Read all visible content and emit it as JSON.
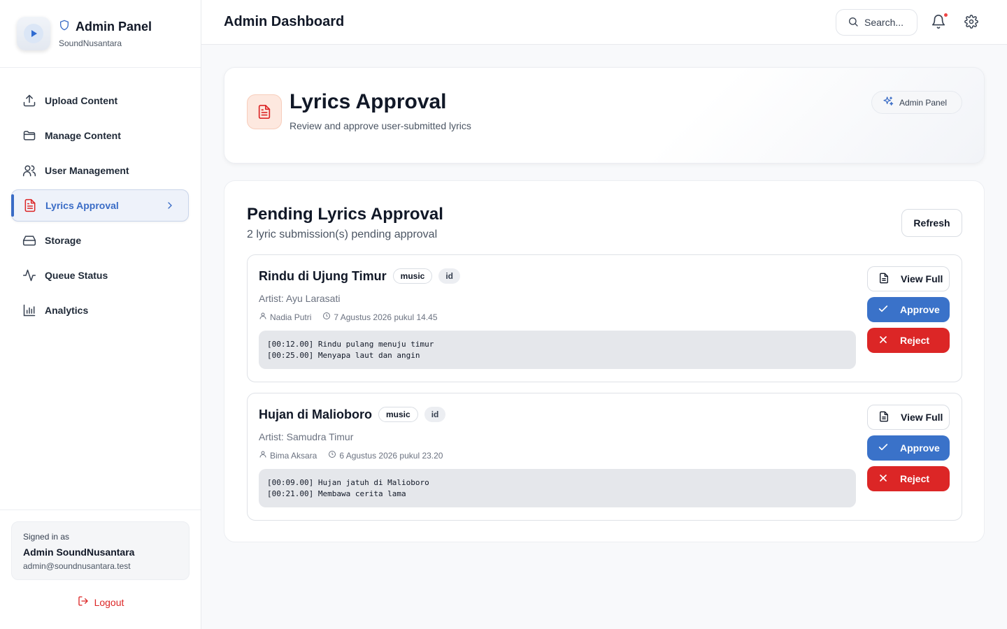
{
  "brand": {
    "title": "Admin Panel",
    "subtitle": "SoundNusantara"
  },
  "nav": [
    {
      "label": "Upload Content",
      "icon": "upload-icon"
    },
    {
      "label": "Manage Content",
      "icon": "folder-icon"
    },
    {
      "label": "User Management",
      "icon": "users-icon"
    },
    {
      "label": "Lyrics Approval",
      "icon": "file-text-icon",
      "active": true
    },
    {
      "label": "Storage",
      "icon": "hard-drive-icon"
    },
    {
      "label": "Queue Status",
      "icon": "activity-icon"
    },
    {
      "label": "Analytics",
      "icon": "bar-chart-icon"
    }
  ],
  "account": {
    "label": "Signed in as",
    "name": "Admin SoundNusantara",
    "email": "admin@soundnusantara.test",
    "logout": "Logout"
  },
  "header": {
    "title": "Admin Dashboard",
    "search_placeholder": "Search..."
  },
  "hero": {
    "title": "Lyrics Approval",
    "subtitle": "Review and approve user-submitted lyrics",
    "badge": "Admin Panel"
  },
  "panel": {
    "title": "Pending Lyrics Approval",
    "subtitle": "2 lyric submission(s) pending approval",
    "refresh": "Refresh",
    "items": [
      {
        "title": "Rindu di Ujung Timur",
        "type_tag": "music",
        "lang_tag": "id",
        "artist": "Artist: Ayu Larasati",
        "submitter": "Nadia Putri",
        "date": "7 Agustus 2026 pukul 14.45",
        "lyrics": "[00:12.00] Rindu pulang menuju timur\n[00:25.00] Menyapa laut dan angin",
        "view": "View Full",
        "approve": "Approve",
        "reject": "Reject"
      },
      {
        "title": "Hujan di Malioboro",
        "type_tag": "music",
        "lang_tag": "id",
        "artist": "Artist: Samudra Timur",
        "submitter": "Bima Aksara",
        "date": "6 Agustus 2026 pukul 23.20",
        "lyrics": "[00:09.00] Hujan jatuh di Malioboro\n[00:21.00] Membawa cerita lama",
        "view": "View Full",
        "approve": "Approve",
        "reject": "Reject"
      }
    ]
  },
  "colors": {
    "accent": "#3a72c9",
    "danger": "#dc2626",
    "active_nav_text": "#3a6cc6"
  }
}
